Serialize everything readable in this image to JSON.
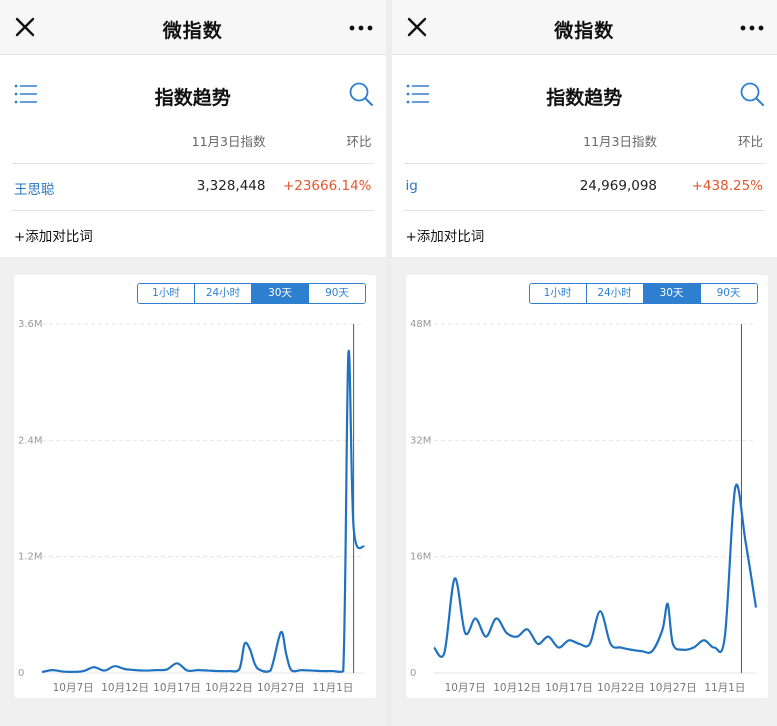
{
  "accent": "#2f7fd0",
  "up_color": "#e2572c",
  "panels": [
    {
      "app_title": "微指数",
      "section_title": "指数趋势",
      "col_index": "11月3日指数",
      "col_change": "环比",
      "keyword": "王思聪",
      "value": "3,328,448",
      "change": "+23666.14%",
      "add_label": "+添加对比词",
      "tabs": [
        {
          "label": "1小时",
          "active": false
        },
        {
          "label": "24小时",
          "active": false
        },
        {
          "label": "30天",
          "active": true
        },
        {
          "label": "90天",
          "active": false
        }
      ],
      "chart_data": {
        "type": "line",
        "ylim": [
          0,
          3600000
        ],
        "y_ticks": [
          0,
          1200000,
          2400000,
          3600000
        ],
        "y_tick_labels": [
          "0",
          "1.2M",
          "2.4M",
          "3.6M"
        ],
        "x_labels": [
          "10月7日",
          "10月12日",
          "10月17日",
          "10月22日",
          "10月27日",
          "11月1日"
        ],
        "x_label_days": [
          3,
          8,
          13,
          18,
          23,
          28
        ],
        "x": [
          0,
          1,
          2,
          3,
          4,
          5,
          6,
          7,
          8,
          9,
          10,
          11,
          12,
          13,
          14,
          15,
          16,
          17,
          18,
          19,
          19.5,
          20,
          20.5,
          21,
          22,
          23,
          23.5,
          24,
          25,
          26,
          27,
          28,
          29,
          29.5,
          30,
          31
        ],
        "values": [
          10000,
          30000,
          15000,
          12000,
          20000,
          60000,
          25000,
          70000,
          40000,
          30000,
          25000,
          30000,
          35000,
          100000,
          25000,
          30000,
          25000,
          20000,
          20000,
          40000,
          300000,
          250000,
          90000,
          30000,
          25000,
          420000,
          200000,
          30000,
          30000,
          25000,
          20000,
          20000,
          20000,
          3300000,
          1500000,
          1300000
        ],
        "cursor_day": 30
      }
    },
    {
      "app_title": "微指数",
      "section_title": "指数趋势",
      "col_index": "11月3日指数",
      "col_change": "环比",
      "keyword": "ig",
      "value": "24,969,098",
      "change": "+438.25%",
      "add_label": "+添加对比词",
      "tabs": [
        {
          "label": "1小时",
          "active": false
        },
        {
          "label": "24小时",
          "active": false
        },
        {
          "label": "30天",
          "active": true
        },
        {
          "label": "90天",
          "active": false
        }
      ],
      "chart_data": {
        "type": "line",
        "ylim": [
          0,
          48000000
        ],
        "y_ticks": [
          0,
          16000000,
          32000000,
          48000000
        ],
        "y_tick_labels": [
          "0",
          "16M",
          "32M",
          "48M"
        ],
        "x_labels": [
          "10月7日",
          "10月12日",
          "10月17日",
          "10月22日",
          "10月27日",
          "11月1日"
        ],
        "x_label_days": [
          3,
          8,
          13,
          18,
          23,
          28
        ],
        "x": [
          0,
          1,
          2,
          3,
          4,
          5,
          6,
          7,
          8,
          9,
          10,
          11,
          12,
          13,
          14,
          15,
          16,
          17,
          18,
          19,
          20,
          21,
          22,
          22.5,
          23,
          24,
          25,
          26,
          27,
          28,
          29,
          30,
          31
        ],
        "values": [
          3500000,
          2800000,
          13000000,
          5500000,
          7500000,
          5000000,
          7500000,
          5500000,
          5000000,
          6000000,
          4000000,
          5000000,
          3500000,
          4500000,
          4000000,
          4000000,
          8500000,
          4000000,
          3500000,
          3200000,
          3000000,
          3000000,
          6000000,
          9500000,
          4000000,
          3200000,
          3500000,
          4500000,
          3500000,
          5000000,
          25500000,
          18000000,
          9000000
        ],
        "cursor_day": 29.6
      }
    }
  ]
}
